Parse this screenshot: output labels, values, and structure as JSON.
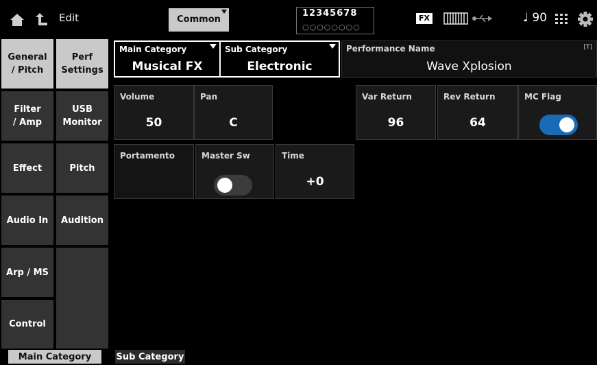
{
  "header": {
    "edit_label": "Edit",
    "common_label": "Common",
    "parts_numbers": "12345678",
    "parts_dots": "○○○○○○○○",
    "fx_label": "FX",
    "tempo": "♩ 90",
    "icons": [
      "home-icon",
      "back-arrow-icon",
      "keyboard-icon",
      "usb-icon",
      "quick-access-grid-icon",
      "settings-gear-icon"
    ]
  },
  "nav_left": [
    {
      "label": "General\n/ Pitch",
      "selected": true
    },
    {
      "label": "Filter\n/ Amp",
      "selected": false
    },
    {
      "label": "Effect",
      "selected": false
    },
    {
      "label": "Audio In",
      "selected": false
    },
    {
      "label": "Arp / MS",
      "selected": false
    },
    {
      "label": "Control",
      "selected": false
    }
  ],
  "nav_right": [
    {
      "label": "Perf\nSettings",
      "selected": true
    },
    {
      "label": "USB\nMonitor",
      "selected": false
    },
    {
      "label": "Pitch",
      "selected": false
    },
    {
      "label": "Audition",
      "selected": false
    }
  ],
  "category": {
    "main_label": "Main Category",
    "main_value": "Musical FX",
    "sub_label": "Sub Category",
    "sub_value": "Electronic",
    "perf_name_label": "Performance Name",
    "perf_name_value": "Wave Xplosion",
    "text_marker": "[T]"
  },
  "params": {
    "volume_label": "Volume",
    "volume_value": "50",
    "pan_label": "Pan",
    "pan_value": "C",
    "var_return_label": "Var Return",
    "var_return_value": "96",
    "rev_return_label": "Rev Return",
    "rev_return_value": "64",
    "mc_flag_label": "MC Flag",
    "mc_flag_on": true,
    "portamento_label": "Portamento",
    "master_sw_label": "Master Sw",
    "master_sw_on": false,
    "time_label": "Time",
    "time_value": "+0"
  },
  "bottom_tabs": [
    {
      "label": "Main Category",
      "selected": true
    },
    {
      "label": "Sub Category",
      "selected": false
    }
  ],
  "colors": {
    "background": "#000000",
    "panel": "#1a1a1a",
    "selected_tab": "#c9c9c9",
    "unselected_tab": "#333333",
    "toggle_on": "#1a6bb5"
  }
}
